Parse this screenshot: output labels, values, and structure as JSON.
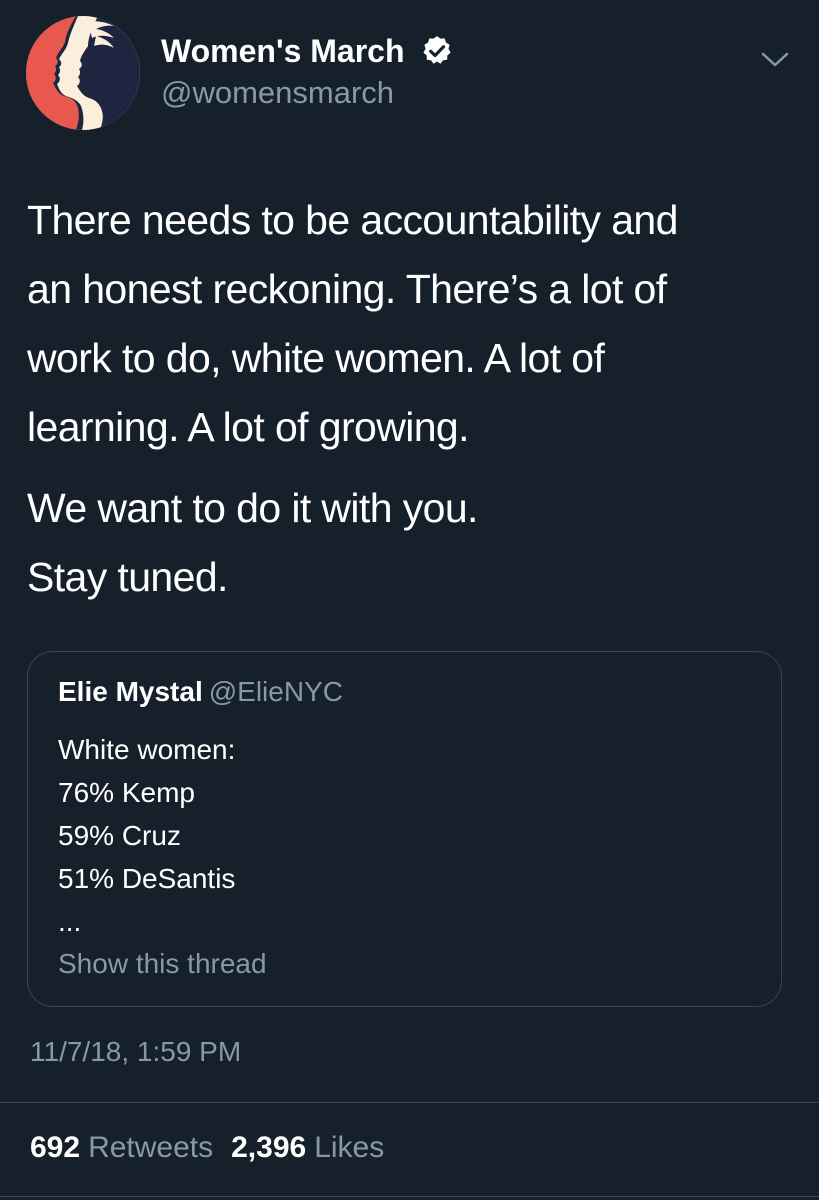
{
  "author": {
    "display_name": "Women's March",
    "handle": "@womensmarch",
    "avatar_icon": "womens-march-logo",
    "verified_icon": "verified-badge-icon"
  },
  "menu_icon": "chevron-down-icon",
  "tweet": {
    "paragraphs": [
      {
        "lines": [
          "There needs to be accountability and",
          "an honest reckoning. There’s a lot of",
          "work to do, white women. A lot of",
          "learning. A lot of growing."
        ]
      },
      {
        "lines": [
          "We want to do it with you.",
          "Stay tuned."
        ]
      }
    ]
  },
  "quoted_tweet": {
    "name": "Elie Mystal",
    "handle": "@ElieNYC",
    "lines": [
      "White women:",
      "76% Kemp",
      "59% Cruz",
      "51% DeSantis",
      "..."
    ],
    "show_thread_label": "Show this thread"
  },
  "timestamp": "11/7/18, 1:59 PM",
  "stats": {
    "retweets_count": "692",
    "retweets_label": "Retweets",
    "likes_count": "2,396",
    "likes_label": "Likes"
  },
  "colors": {
    "background": "#15202b",
    "secondary_text": "#8899a6",
    "border": "#38444d",
    "logo_red": "#e8584f",
    "logo_navy": "#1d2540"
  }
}
